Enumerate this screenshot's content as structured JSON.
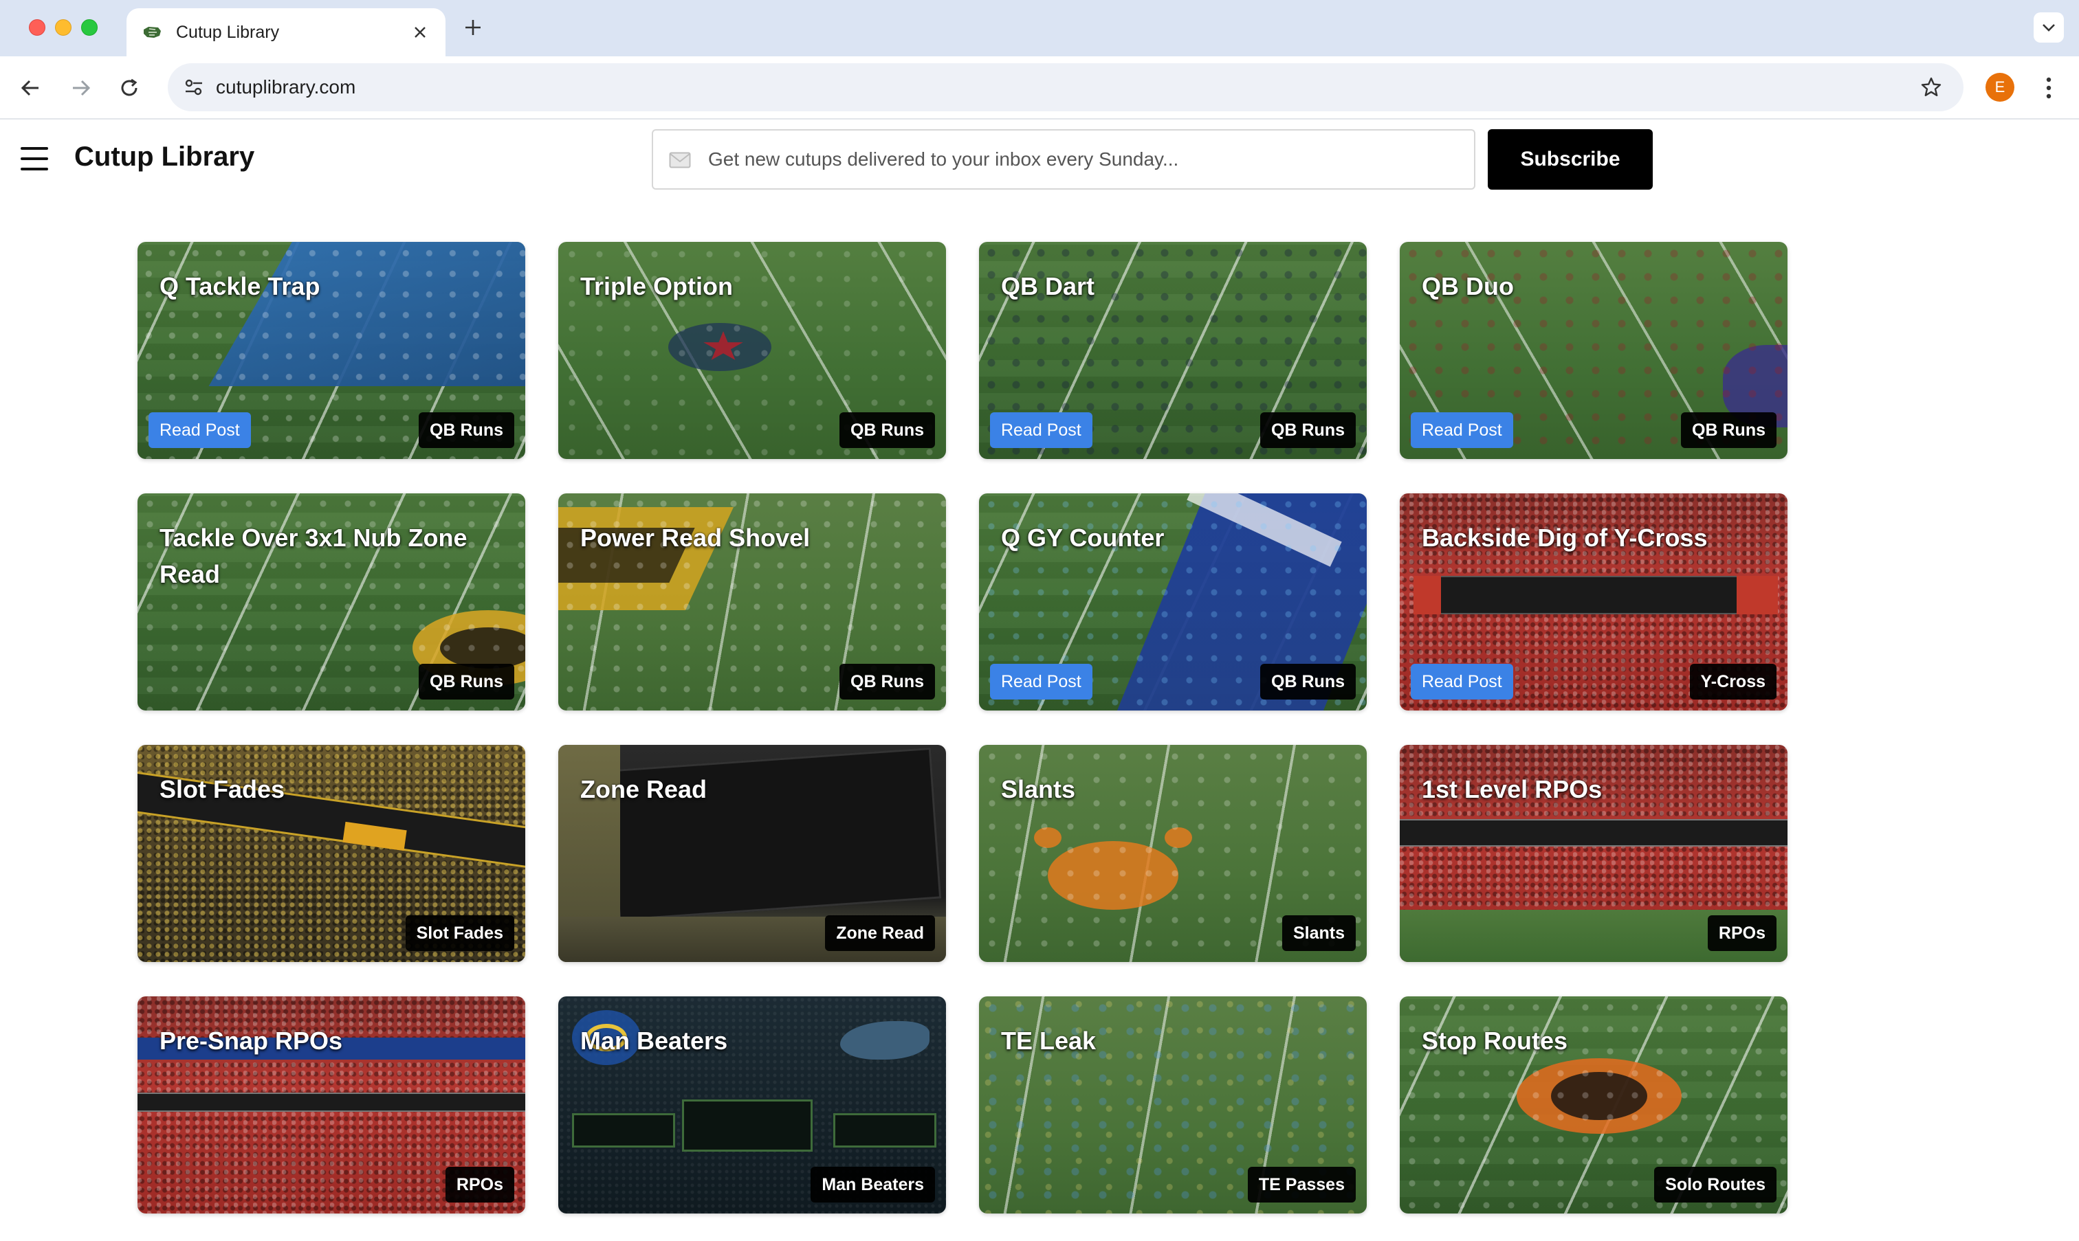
{
  "browser": {
    "tab_title": "Cutup Library",
    "url": "cutuplibrary.com",
    "profile_initial": "E"
  },
  "header": {
    "site_title": "Cutup Library",
    "subscribe_placeholder": "Get new cutups delivered to your inbox every Sunday...",
    "subscribe_label": "Subscribe"
  },
  "colors": {
    "read_post_badge": "#3b82e6",
    "tag_badge": "#000000",
    "subscribe_button": "#000000",
    "profile_avatar": "#e8710a"
  },
  "cards": [
    {
      "title": "Q Tackle Trap",
      "read_post": "Read Post",
      "tag": "QB Runs"
    },
    {
      "title": "Triple Option",
      "read_post": "",
      "tag": "QB Runs"
    },
    {
      "title": "QB Dart",
      "read_post": "Read Post",
      "tag": "QB Runs"
    },
    {
      "title": "QB Duo",
      "read_post": "Read Post",
      "tag": "QB Runs"
    },
    {
      "title": "Tackle Over 3x1 Nub Zone Read",
      "read_post": "",
      "tag": "QB Runs"
    },
    {
      "title": "Power Read Shovel",
      "read_post": "",
      "tag": "QB Runs"
    },
    {
      "title": "Q GY Counter",
      "read_post": "Read Post",
      "tag": "QB Runs"
    },
    {
      "title": "Backside Dig of Y-Cross",
      "read_post": "Read Post",
      "tag": "Y-Cross"
    },
    {
      "title": "Slot Fades",
      "read_post": "",
      "tag": "Slot Fades"
    },
    {
      "title": "Zone Read",
      "read_post": "",
      "tag": "Zone Read"
    },
    {
      "title": "Slants",
      "read_post": "",
      "tag": "Slants"
    },
    {
      "title": "1st Level RPOs",
      "read_post": "",
      "tag": "RPOs"
    },
    {
      "title": "Pre-Snap RPOs",
      "read_post": "",
      "tag": "RPOs"
    },
    {
      "title": "Man Beaters",
      "read_post": "",
      "tag": "Man Beaters"
    },
    {
      "title": "TE Leak",
      "read_post": "",
      "tag": "TE Passes"
    },
    {
      "title": "Stop Routes",
      "read_post": "",
      "tag": "Solo Routes"
    }
  ]
}
